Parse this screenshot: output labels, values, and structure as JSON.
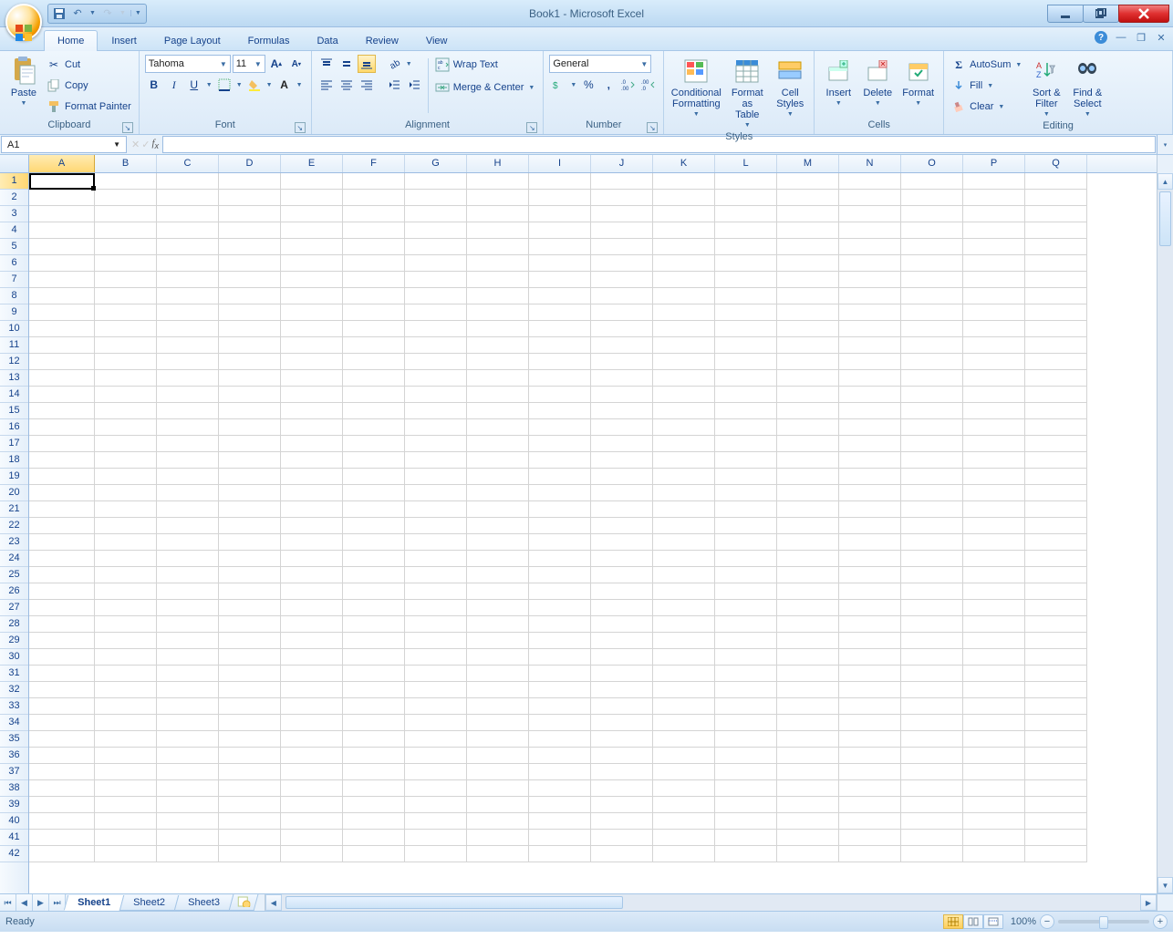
{
  "title": "Book1 - Microsoft Excel",
  "qat": {
    "save": "💾",
    "undo": "↶",
    "redo": "↷"
  },
  "tabs": [
    "Home",
    "Insert",
    "Page Layout",
    "Formulas",
    "Data",
    "Review",
    "View"
  ],
  "active_tab": "Home",
  "ribbon": {
    "clipboard": {
      "label": "Clipboard",
      "paste": "Paste",
      "cut": "Cut",
      "copy": "Copy",
      "format_painter": "Format Painter"
    },
    "font": {
      "label": "Font",
      "name": "Tahoma",
      "size": "11"
    },
    "alignment": {
      "label": "Alignment",
      "wrap": "Wrap Text",
      "merge": "Merge & Center"
    },
    "number": {
      "label": "Number",
      "format": "General"
    },
    "styles": {
      "label": "Styles",
      "cond": "Conditional Formatting",
      "table": "Format as Table",
      "cell": "Cell Styles"
    },
    "cells": {
      "label": "Cells",
      "insert": "Insert",
      "delete": "Delete",
      "format": "Format"
    },
    "editing": {
      "label": "Editing",
      "autosum": "AutoSum",
      "fill": "Fill",
      "clear": "Clear",
      "sort": "Sort & Filter",
      "find": "Find & Select"
    }
  },
  "namebox": "A1",
  "columns": [
    "A",
    "B",
    "C",
    "D",
    "E",
    "F",
    "G",
    "H",
    "I",
    "J",
    "K",
    "L",
    "M",
    "N",
    "O",
    "P",
    "Q"
  ],
  "rows": 42,
  "selected_cell": "A1",
  "sheets": [
    "Sheet1",
    "Sheet2",
    "Sheet3"
  ],
  "active_sheet": "Sheet1",
  "status": "Ready",
  "zoom": "100%"
}
